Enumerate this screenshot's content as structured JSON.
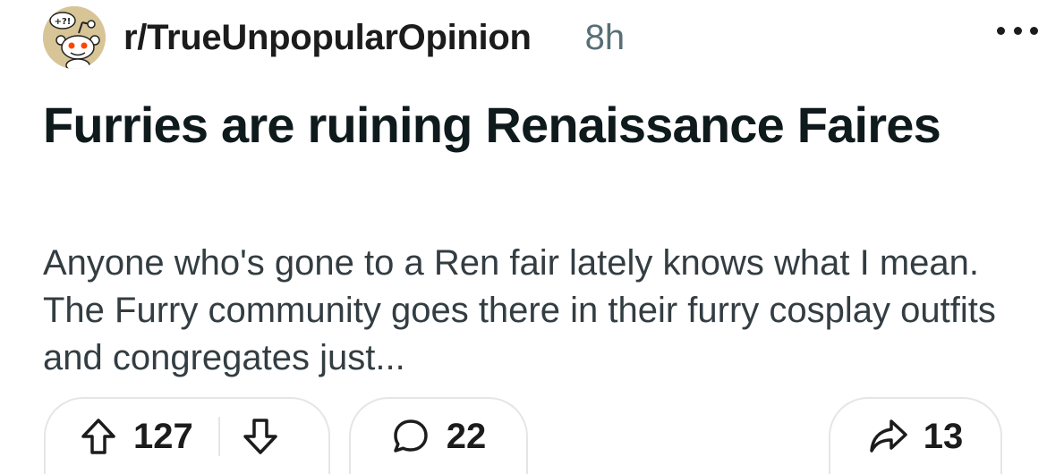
{
  "header": {
    "subreddit": "r/TrueUnpopularOpinion",
    "time": "8h",
    "avatar_icon": "subreddit-avatar-icon",
    "more_icon": "more-options-icon"
  },
  "post": {
    "title": "Furries are ruining Renaissance Faires",
    "body": "Anyone who's gone to a Ren fair lately knows what I mean. The Furry community goes there in their furry cosplay outfits and congregates just..."
  },
  "actions": {
    "upvote_icon": "upvote-arrow-icon",
    "vote_count": "127",
    "downvote_icon": "downvote-arrow-icon",
    "comment_icon": "comment-bubble-icon",
    "comment_count": "22",
    "share_icon": "share-arrow-icon",
    "share_count": "13"
  },
  "colors": {
    "text_primary": "#1c1c1c",
    "text_secondary": "#576f76",
    "body_text": "#333d42",
    "border": "#e3e6e8",
    "avatar_bg": "#d8c597",
    "snoo_face": "#ff4500"
  }
}
